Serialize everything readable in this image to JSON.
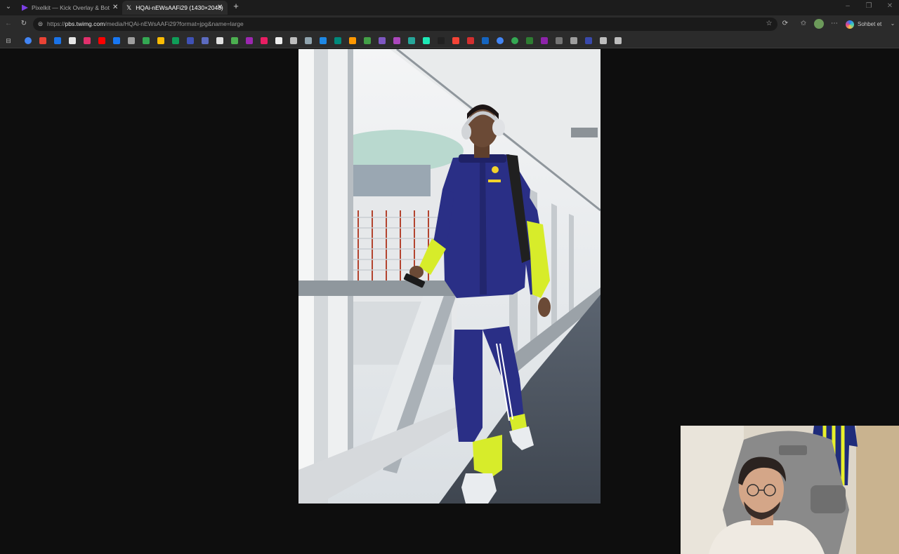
{
  "tabs": [
    {
      "title": "Pixelkit — Kick Overlay & Bot",
      "active": false
    },
    {
      "title": "HQAi-nEWsAAFi29 (1430×2048)",
      "active": true
    }
  ],
  "address_bar": {
    "url_prefix": "https://",
    "url_host": "pbs.twimg.com",
    "url_path": "/media/HQAi-nEWsAAFi29?format=jpg&name=large"
  },
  "toolbar": {
    "copilot_label": "Sohbet et"
  },
  "bookmarks": [
    {
      "icon": "google-icon",
      "color": "#4285f4"
    },
    {
      "icon": "gmail-icon",
      "color": "#ea4335"
    },
    {
      "icon": "maps-icon",
      "color": "#1a73e8"
    },
    {
      "icon": "x-icon",
      "color": "#e6e6e6"
    },
    {
      "icon": "instagram-icon",
      "color": "#e1306c"
    },
    {
      "icon": "youtube-icon",
      "color": "#ff0000"
    },
    {
      "icon": "facebook-icon",
      "color": "#1877f2"
    },
    {
      "icon": "bookmark-icon",
      "color": "#9e9e9e"
    },
    {
      "icon": "sheets-icon",
      "color": "#34a853"
    },
    {
      "icon": "bookmark-icon",
      "color": "#fbbc04"
    },
    {
      "icon": "bookmark-icon",
      "color": "#0f9d58"
    },
    {
      "icon": "bookmark-icon",
      "color": "#3f51b5"
    },
    {
      "icon": "bookmark-icon",
      "color": "#5c6bc0"
    },
    {
      "icon": "bookmark-icon",
      "color": "#e0e0e0"
    },
    {
      "icon": "bookmark-icon",
      "color": "#4caf50"
    },
    {
      "icon": "bookmark-icon",
      "color": "#9c27b0"
    },
    {
      "icon": "bookmark-icon",
      "color": "#e91e63"
    },
    {
      "icon": "bookmark-icon",
      "color": "#eeeeee"
    },
    {
      "icon": "bookmark-icon",
      "color": "#bdbdbd"
    },
    {
      "icon": "bookmark-icon",
      "color": "#90a4ae"
    },
    {
      "icon": "bookmark-icon",
      "color": "#1e88e5"
    },
    {
      "icon": "bookmark-icon",
      "color": "#00897b"
    },
    {
      "icon": "bookmark-icon",
      "color": "#ff9800"
    },
    {
      "icon": "bookmark-icon",
      "color": "#43a047"
    },
    {
      "icon": "bookmark-icon",
      "color": "#7e57c2"
    },
    {
      "icon": "bookmark-icon",
      "color": "#ab47bc"
    },
    {
      "icon": "bookmark-icon",
      "color": "#26a69a"
    },
    {
      "icon": "bookmark-icon",
      "color": "#1de9b6"
    },
    {
      "icon": "bookmark-icon",
      "color": "#212121"
    },
    {
      "icon": "bookmark-icon",
      "color": "#f44336"
    },
    {
      "icon": "bookmark-icon",
      "color": "#d32f2f"
    },
    {
      "icon": "bookmark-icon",
      "color": "#1565c0"
    },
    {
      "icon": "google-icon",
      "color": "#4285f4"
    },
    {
      "icon": "google-icon",
      "color": "#34a853"
    },
    {
      "icon": "bookmark-icon",
      "color": "#2e7d32"
    },
    {
      "icon": "bookmark-icon",
      "color": "#8e24aa"
    },
    {
      "icon": "bookmark-icon",
      "color": "#757575"
    },
    {
      "icon": "bookmark-icon",
      "color": "#9e9e9e"
    },
    {
      "icon": "bookmark-icon",
      "color": "#3949ab"
    },
    {
      "icon": "folder-icon",
      "color": "#bdbdbd"
    },
    {
      "icon": "link-icon",
      "color": "#bdbdbd"
    }
  ],
  "colors": {
    "page_background": "#0e0e0e",
    "chrome_background": "#2b2b2b",
    "tabstrip_background": "#1c1c1c",
    "jersey_navy": "#2a2f86",
    "jersey_yellow": "#d7ec2a"
  }
}
